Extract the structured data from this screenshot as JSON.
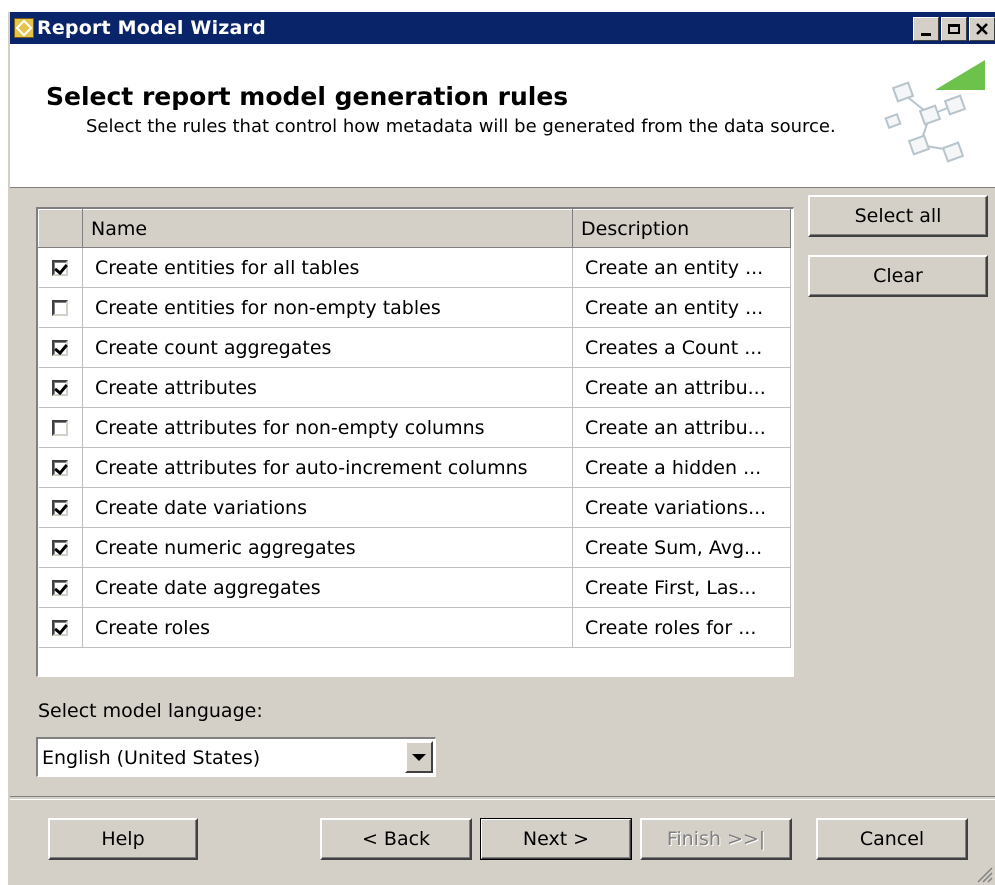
{
  "window": {
    "title": "Report Model Wizard"
  },
  "header": {
    "title": "Select report model generation rules",
    "description": "Select the rules that control how metadata will be generated from the data source."
  },
  "rules_grid": {
    "columns": [
      "Name",
      "Description"
    ],
    "rows": [
      {
        "checked": true,
        "name": "Create entities for all tables",
        "description": "Create an entity ..."
      },
      {
        "checked": false,
        "name": "Create entities for non-empty tables",
        "description": "Create an entity ..."
      },
      {
        "checked": true,
        "name": "Create count aggregates",
        "description": "Creates a Count ..."
      },
      {
        "checked": true,
        "name": "Create attributes",
        "description": "Create an attribu..."
      },
      {
        "checked": false,
        "name": "Create attributes for non-empty columns",
        "description": "Create an attribu..."
      },
      {
        "checked": true,
        "name": "Create attributes for auto-increment columns",
        "description": "Create a hidden ..."
      },
      {
        "checked": true,
        "name": "Create date variations",
        "description": "Create variations..."
      },
      {
        "checked": true,
        "name": "Create numeric aggregates",
        "description": "Create Sum, Avg..."
      },
      {
        "checked": true,
        "name": "Create date aggregates",
        "description": "Create First, Las..."
      },
      {
        "checked": true,
        "name": "Create roles",
        "description": "Create roles for ..."
      }
    ]
  },
  "side_buttons": {
    "select_all": "Select all",
    "clear": "Clear"
  },
  "language": {
    "label": "Select model language:",
    "value": "English (United States)"
  },
  "footer": {
    "help": "Help",
    "back": "< Back",
    "next": "Next >",
    "finish": "Finish >>|",
    "cancel": "Cancel"
  }
}
